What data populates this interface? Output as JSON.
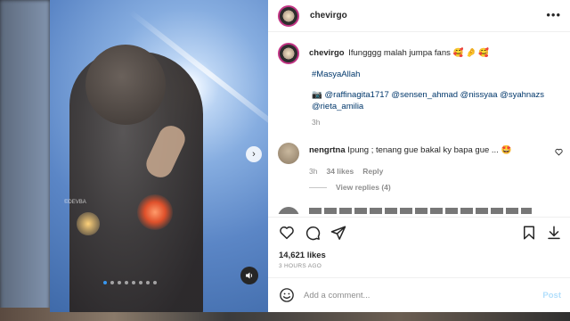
{
  "post": {
    "username": "chevirgo",
    "caption_user": "chevirgo",
    "caption": "Ifungggg malah jumpa fans 🥰 🤌 🥰",
    "hashtag": "#MasyaAllah",
    "mentions": "📷 @raffinagita1717 @sensen_ahmad @nissyaa @syahnazs @rieta_amilia",
    "caption_time": "3h",
    "media_watermark": "©DEVBA",
    "carousel_dots": 8,
    "active_dot": 0
  },
  "comment": {
    "username": "nengrtna",
    "text": "Ipung ; tenang gue bakal ky bapa gue ... 🤩",
    "time": "3h",
    "likes": "34 likes",
    "reply": "Reply",
    "view_replies": "View replies (4)"
  },
  "stats": {
    "likes": "14,621 likes",
    "time": "3 HOURS AGO"
  },
  "comment_box": {
    "placeholder": "Add a comment...",
    "post_label": "Post"
  },
  "icons": {
    "more": "more-horizontal-icon",
    "heart": "heart-icon",
    "comment": "comment-icon",
    "share": "share-icon",
    "save": "bookmark-icon",
    "emoji": "emoji-icon",
    "next": "chevron-right-icon",
    "sound": "speaker-icon"
  },
  "colors": {
    "link": "#00376b",
    "muted": "#8e8e8e",
    "post_button": "#b2dffc",
    "story_ring": "#c13584"
  }
}
